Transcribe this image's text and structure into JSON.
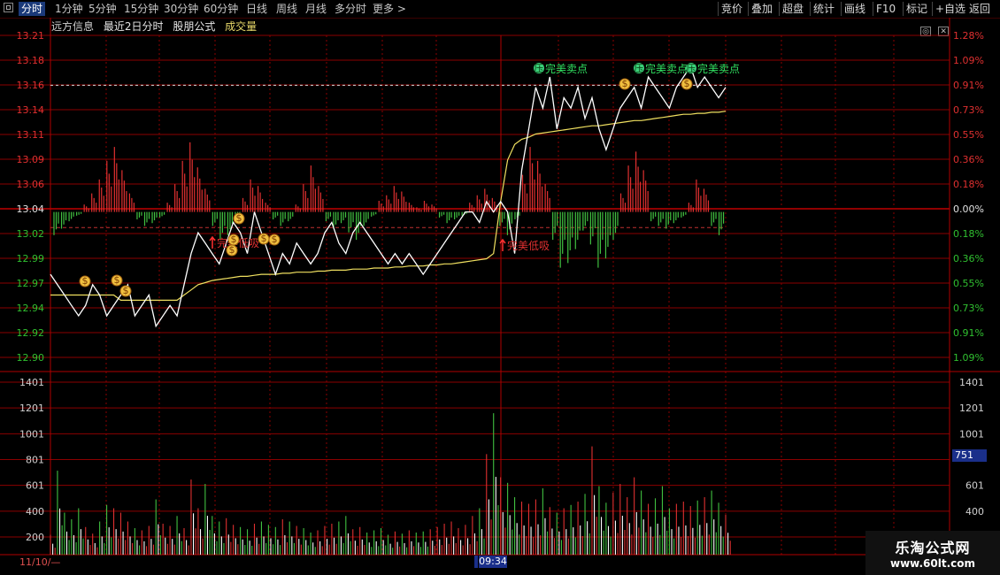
{
  "toolbar": {
    "left_items": [
      "分时",
      "1分钟",
      "5分钟",
      "15分钟",
      "30分钟",
      "60分钟",
      "日线",
      "周线",
      "月线",
      "多分时",
      "更多 >"
    ],
    "right_items": [
      "竞价",
      "叠加",
      "超盘",
      "统计",
      "画线",
      "F10",
      "标记",
      "+自选",
      "返回"
    ],
    "active_index": 0
  },
  "subheader": {
    "stock_name": "远方信息",
    "period": "最近2日分时",
    "formula": "股朋公式",
    "indicator": "成交量"
  },
  "window_controls": [
    "◎",
    "✕"
  ],
  "price_axis": {
    "left_labels": [
      "13.21",
      "13.18",
      "13.16",
      "13.14",
      "13.11",
      "13.09",
      "13.06",
      "13.04",
      "13.02",
      "12.99",
      "12.97",
      "12.94",
      "12.92",
      "12.90"
    ],
    "right_labels": [
      "1.28%",
      "1.09%",
      "0.91%",
      "0.73%",
      "0.55%",
      "0.36%",
      "0.18%",
      "0.00%",
      "0.18%",
      "0.36%",
      "0.55%",
      "0.73%",
      "0.91%",
      "1.09%"
    ]
  },
  "volume_axis": {
    "left_labels": [
      "1401",
      "1201",
      "1001",
      "801",
      "601",
      "400",
      "200"
    ],
    "right_labels": [
      "1401",
      "1201",
      "1001",
      "",
      "601",
      "400",
      "200"
    ],
    "current_volume": "751"
  },
  "signals": {
    "sell_label": "完美卖点",
    "sell_icon_text": "压",
    "buy_label": "完美低吸"
  },
  "footer": {
    "date": "11/10/—",
    "time": "09:34"
  },
  "watermark": {
    "title": "乐淘公式网",
    "url": "www.60lt.com"
  },
  "colors": {
    "grid": "#8b0000",
    "price_line": "#ffffff",
    "avg_line": "#f0e060",
    "up": "#e03030",
    "down": "#40c040",
    "up_text": "#e03030",
    "down_text": "#30c030",
    "sell_text": "#30e060",
    "highlight": "#1a2f8a"
  },
  "chart_data": {
    "type": "line",
    "title": "",
    "xlabel": "",
    "ylabel": "",
    "ylim": [
      12.89,
      13.22
    ],
    "series": [
      {
        "name": "price",
        "values": [
          12.98,
          12.97,
          12.96,
          12.95,
          12.94,
          12.95,
          12.97,
          12.96,
          12.94,
          12.95,
          12.96,
          12.97,
          12.94,
          12.95,
          12.96,
          12.93,
          12.94,
          12.95,
          12.94,
          12.97,
          13.0,
          13.02,
          13.01,
          13.0,
          12.99,
          13.01,
          13.03,
          13.02,
          13.0,
          13.04,
          13.02,
          13.0,
          12.98,
          13.0,
          12.99,
          13.01,
          13.0,
          12.99,
          13.0,
          13.02,
          13.03,
          13.01,
          13.0,
          13.02,
          13.03,
          13.02,
          13.01,
          13.0,
          12.99,
          13.0,
          12.99,
          13.0,
          12.99,
          12.98,
          12.99,
          13.0,
          13.01,
          13.02,
          13.03,
          13.04,
          13.04,
          13.03,
          13.05,
          13.04,
          13.05,
          13.04,
          13.0,
          13.08,
          13.12,
          13.16,
          13.14,
          13.17,
          13.12,
          13.15,
          13.14,
          13.16,
          13.13,
          13.15,
          13.12,
          13.1,
          13.12,
          13.14,
          13.15,
          13.16,
          13.14,
          13.17,
          13.16,
          13.15,
          13.14,
          13.16,
          13.17,
          13.18,
          13.16,
          13.17,
          13.16,
          13.15,
          13.16
        ],
        "volume": [
          180,
          760,
          380,
          320,
          420,
          250,
          190,
          300,
          450,
          420,
          380,
          300,
          240,
          220,
          260,
          500,
          280,
          260,
          350,
          240,
          680,
          420,
          640,
          350,
          300,
          330,
          270,
          250,
          230,
          280,
          300,
          270,
          250,
          320,
          300,
          260,
          240,
          200,
          220,
          260,
          280,
          300,
          350,
          230,
          250,
          200,
          220,
          240,
          180,
          210,
          190,
          220,
          200,
          210,
          230,
          250,
          280,
          300,
          240,
          270,
          350,
          420,
          910,
          1280,
          700,
          650,
          520,
          480,
          460,
          500,
          600,
          430,
          380,
          420,
          450,
          480,
          550,
          980,
          620,
          470,
          560,
          640,
          520,
          700,
          580,
          460,
          510,
          620,
          420,
          460,
          480,
          440,
          490,
          520,
          580,
          470,
          360
        ]
      },
      {
        "name": "average",
        "values": [
          12.96,
          12.96,
          12.96,
          12.96,
          12.96,
          12.96,
          12.96,
          12.96,
          12.96,
          12.96,
          12.955,
          12.955,
          12.955,
          12.955,
          12.955,
          12.955,
          12.955,
          12.955,
          12.955,
          12.96,
          12.965,
          12.97,
          12.972,
          12.974,
          12.975,
          12.976,
          12.977,
          12.978,
          12.978,
          12.979,
          12.98,
          12.98,
          12.98,
          12.981,
          12.981,
          12.982,
          12.982,
          12.982,
          12.983,
          12.983,
          12.984,
          12.984,
          12.984,
          12.985,
          12.985,
          12.985,
          12.986,
          12.986,
          12.986,
          12.987,
          12.987,
          12.988,
          12.988,
          12.988,
          12.989,
          12.989,
          12.99,
          12.99,
          12.991,
          12.992,
          12.993,
          12.994,
          12.995,
          13.0,
          13.05,
          13.09,
          13.105,
          13.11,
          13.112,
          13.115,
          13.116,
          13.117,
          13.118,
          13.119,
          13.12,
          13.121,
          13.122,
          13.123,
          13.123,
          13.124,
          13.125,
          13.126,
          13.127,
          13.128,
          13.128,
          13.129,
          13.13,
          13.131,
          13.132,
          13.133,
          13.134,
          13.134,
          13.135,
          13.135,
          13.136,
          13.136,
          13.137
        ]
      }
    ],
    "bars_baseline": 13.04,
    "macd_bars": [
      {
        "v": -25
      },
      {
        "v": -18
      },
      {
        "v": -10
      },
      {
        "v": -4
      },
      {
        "v": 8
      },
      {
        "v": 20
      },
      {
        "v": 35
      },
      {
        "v": 55
      },
      {
        "v": 70
      },
      {
        "v": 45
      },
      {
        "v": 20
      },
      {
        "v": -8
      },
      {
        "v": -15
      },
      {
        "v": -12
      },
      {
        "v": -6
      },
      {
        "v": 10
      },
      {
        "v": 30
      },
      {
        "v": 55
      },
      {
        "v": 75
      },
      {
        "v": 48
      },
      {
        "v": 25
      },
      {
        "v": -15
      },
      {
        "v": -30
      },
      {
        "v": -25
      },
      {
        "v": -10
      },
      {
        "v": 15
      },
      {
        "v": 35
      },
      {
        "v": 28
      },
      {
        "v": 10
      },
      {
        "v": -8
      },
      {
        "v": -15
      },
      {
        "v": -10
      },
      {
        "v": 8
      },
      {
        "v": 30
      },
      {
        "v": 50
      },
      {
        "v": 28
      },
      {
        "v": -10
      },
      {
        "v": -18
      },
      {
        "v": -12
      },
      {
        "v": -22
      },
      {
        "v": -30
      },
      {
        "v": -15
      },
      {
        "v": -5
      },
      {
        "v": 12
      },
      {
        "v": 18
      },
      {
        "v": 28
      },
      {
        "v": 22
      },
      {
        "v": 10
      },
      {
        "v": 5
      },
      {
        "v": 12
      },
      {
        "v": 8
      },
      {
        "v": -6
      },
      {
        "v": -12
      },
      {
        "v": -8
      },
      {
        "v": -4
      },
      {
        "v": 10
      },
      {
        "v": 18
      },
      {
        "v": 25
      },
      {
        "v": 15
      },
      {
        "v": -15
      },
      {
        "v": -25
      },
      {
        "v": -8
      },
      {
        "v": 40
      },
      {
        "v": 70
      },
      {
        "v": 55
      },
      {
        "v": 30
      },
      {
        "v": -30
      },
      {
        "v": -60
      },
      {
        "v": -55
      },
      {
        "v": -40
      },
      {
        "v": -20
      },
      {
        "v": -35
      },
      {
        "v": -60
      },
      {
        "v": -50
      },
      {
        "v": -30
      },
      {
        "v": 20
      },
      {
        "v": 50
      },
      {
        "v": 65
      },
      {
        "v": 45
      },
      {
        "v": -10
      },
      {
        "v": -15
      },
      {
        "v": -18
      },
      {
        "v": -12
      },
      {
        "v": -6
      },
      {
        "v": 10
      },
      {
        "v": 35
      },
      {
        "v": 25
      },
      {
        "v": -15
      },
      {
        "v": -25
      }
    ]
  }
}
